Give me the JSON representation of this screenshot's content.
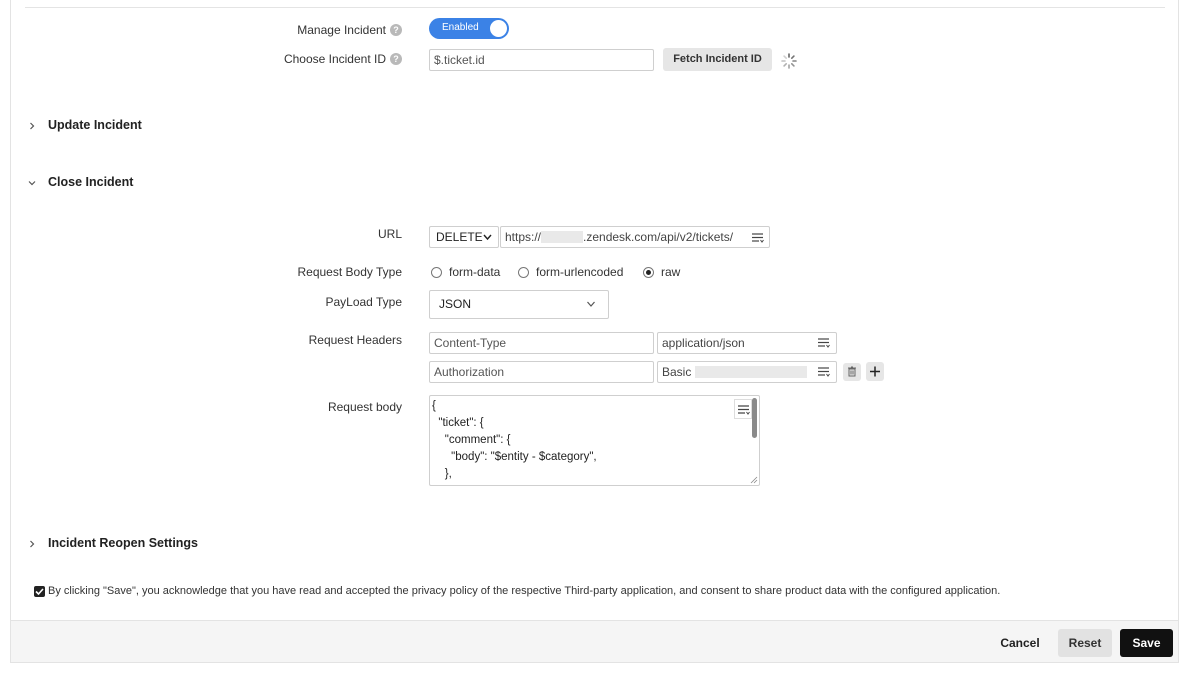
{
  "manage": {
    "label": "Manage Incident",
    "toggle_text": "Enabled"
  },
  "choose": {
    "label": "Choose Incident ID",
    "value": "$.ticket.id",
    "fetch_label": "Fetch Incident ID"
  },
  "sections": {
    "update": "Update Incident",
    "close": "Close Incident",
    "reopen": "Incident Reopen Settings"
  },
  "url": {
    "label": "URL",
    "method": "DELETE",
    "prefix": "https://",
    "suffix": ".zendesk.com/api/v2/tickets/"
  },
  "body_type": {
    "label": "Request Body Type",
    "options": [
      "form-data",
      "form-urlencoded",
      "raw"
    ],
    "selected": "raw"
  },
  "payload": {
    "label": "PayLoad Type",
    "value": "JSON"
  },
  "headers": {
    "label": "Request Headers",
    "rows": [
      {
        "key": "Content-Type",
        "value": "application/json"
      },
      {
        "key": "Authorization",
        "value": "Basic"
      }
    ]
  },
  "request_body": {
    "label": "Request body",
    "lines": [
      "{",
      "  \"ticket\": {",
      "    \"comment\": {",
      "      \"body\": \"$entity - $category\",",
      "    },"
    ]
  },
  "consent": {
    "text": "By clicking \"Save\", you acknowledge that you have read and accepted the privacy policy of the respective Third-party application, and consent to share product data with the configured application."
  },
  "footer": {
    "cancel": "Cancel",
    "reset": "Reset",
    "save": "Save"
  },
  "colors": {
    "toggle": "#3b82e6",
    "save_bg": "#111111"
  }
}
